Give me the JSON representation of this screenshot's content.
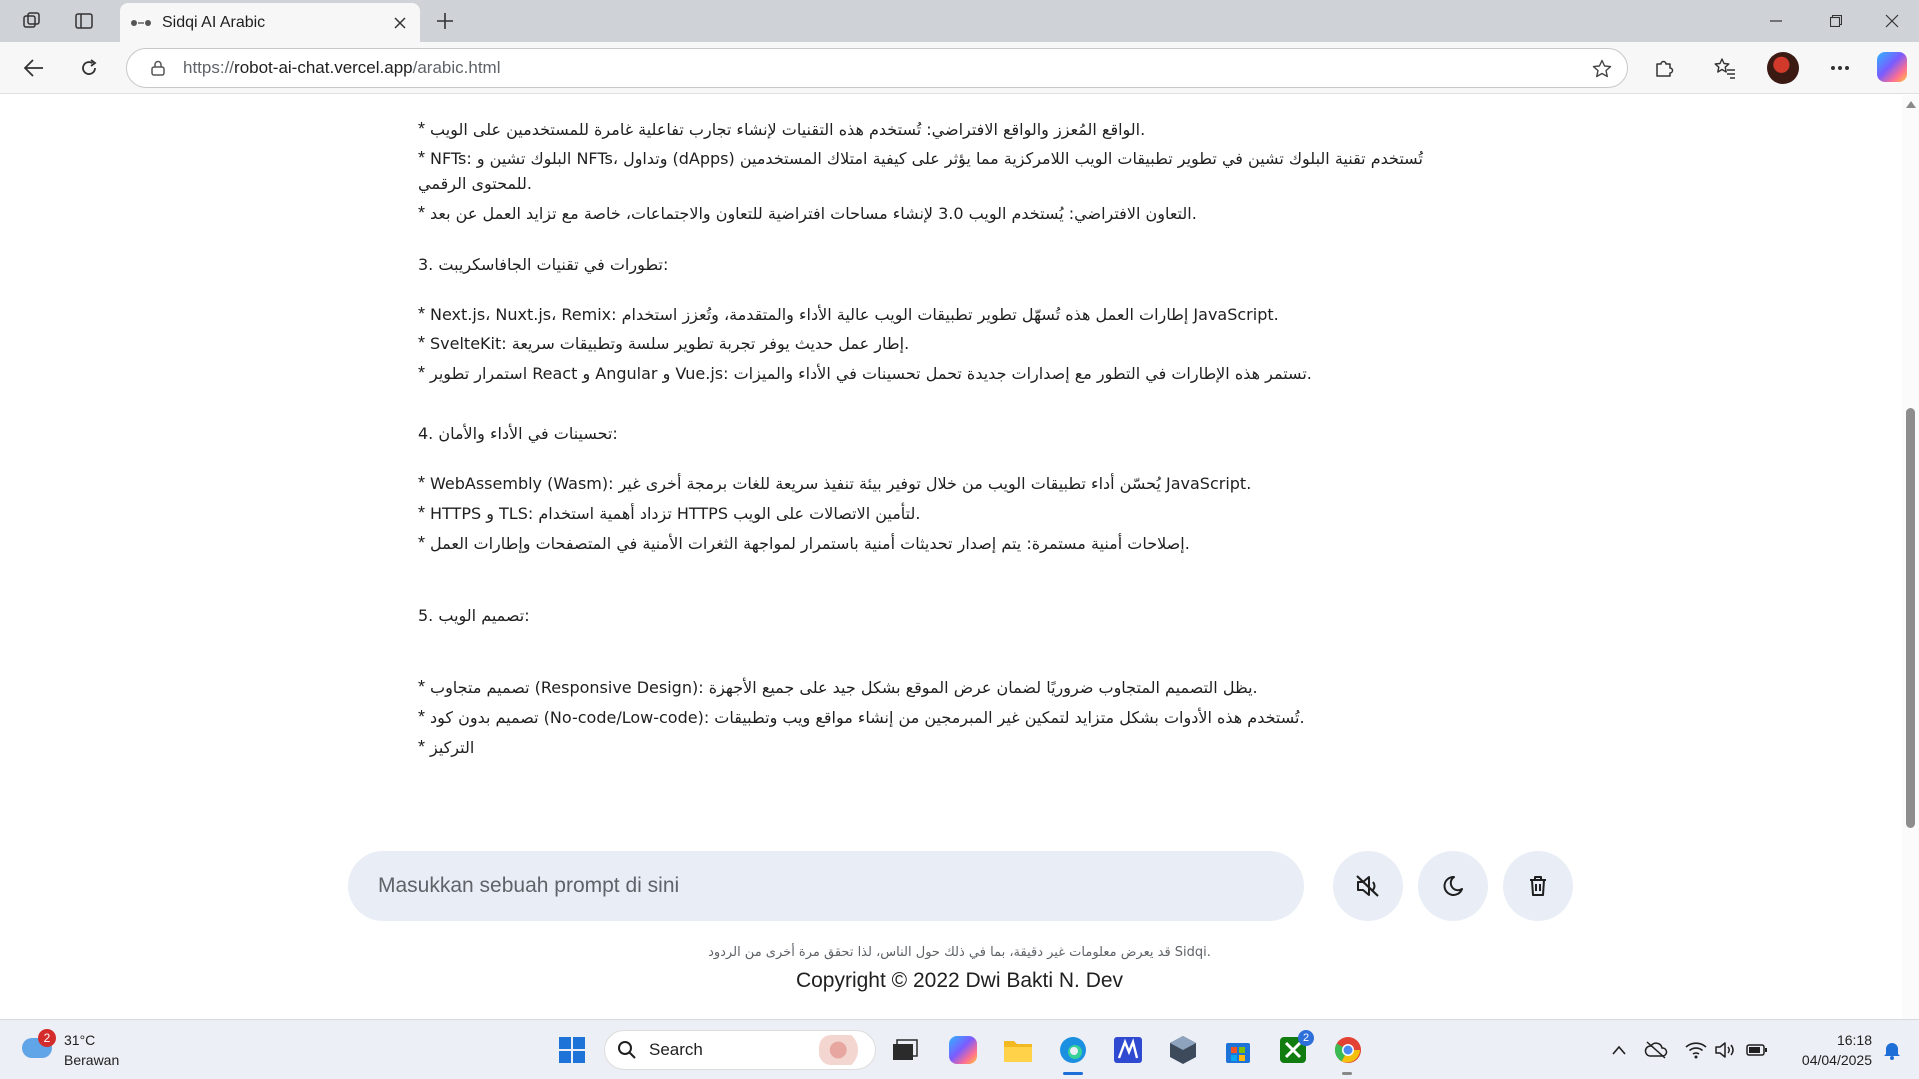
{
  "browser": {
    "tab_title": "Sidqi AI Arabic",
    "url_prefix": "https://",
    "url_host": "robot-ai-chat.vercel.app",
    "url_path": "/arabic.html"
  },
  "content": {
    "lines": [
      {
        "text": "الواقع المُعزز والواقع الافتراضي: تُستخدم هذه التقنيات لإنشاء تجارب تفاعلية غامرة للمستخدمين على الويب.",
        "prefix": "* "
      },
      {
        "text": "NFTs: البلوك تشين و NFTs، وتداول (dApps) تُستخدم تقنية البلوك تشين في تطوير تطبيقات الويب اللامركزية مما يؤثر على كيفية امتلاك المستخدمين",
        "prefix": "* "
      },
      {
        "text": "للمحتوى الرقمي.",
        "prefix": ""
      },
      {
        "text": "التعاون الافتراضي: يُستخدم الويب 3.0 لإنشاء مساحات افتراضية للتعاون والاجتماعات، خاصة مع تزايد العمل عن بعد.",
        "prefix": "* "
      },
      {
        "text": "3. تطورات في تقنيات الجافاسكريبت:",
        "prefix": ""
      },
      {
        "text": "Next.js، Nuxt.js، Remix: إطارات العمل هذه تُسهّل تطوير تطبيقات الويب عالية الأداء والمتقدمة، وتُعزز استخدام JavaScript.",
        "prefix": "* "
      },
      {
        "text": "SvelteKit: إطار عمل حديث يوفر تجربة تطوير سلسة وتطبيقات سريعة.",
        "prefix": "* "
      },
      {
        "text": "استمرار تطوير React و Angular و Vue.js: تستمر هذه الإطارات في التطور مع إصدارات جديدة تحمل تحسينات في الأداء والميزات.",
        "prefix": "* "
      },
      {
        "text": "4. تحسينات في الأداء والأمان:",
        "prefix": ""
      },
      {
        "text": "WebAssembly (Wasm): يُحسّن أداء تطبيقات الويب من خلال توفير بيئة تنفيذ سريعة للغات برمجة أخرى غير JavaScript.",
        "prefix": "* "
      },
      {
        "text": "HTTPS و TLS: تزداد أهمية استخدام HTTPS لتأمين الاتصالات على الويب.",
        "prefix": "* "
      },
      {
        "text": "إصلاحات أمنية مستمرة: يتم إصدار تحديثات أمنية باستمرار لمواجهة الثغرات الأمنية في المتصفحات وإطارات العمل.",
        "prefix": "* "
      },
      {
        "text": "5. تصميم الويب:",
        "prefix": ""
      },
      {
        "text": "تصميم متجاوب (Responsive Design): يظل التصميم المتجاوب ضروريًا لضمان عرض الموقع بشكل جيد على جميع الأجهزة.",
        "prefix": "* "
      },
      {
        "text": "تصميم بدون كود (No-code/Low-code): تُستخدم هذه الأدوات بشكل متزايد لتمكين غير المبرمجين من إنشاء مواقع ويب وتطبيقات.",
        "prefix": "* "
      },
      {
        "text": "التركيز",
        "prefix": "* "
      }
    ]
  },
  "prompt": {
    "placeholder": "Masukkan sebuah prompt di sini"
  },
  "footer": {
    "disclaimer": "قد يعرض معلومات غير دقيقة، بما في ذلك حول الناس، لذا تحقق مرة أخرى من الردود Sidqi.",
    "copyright": "Copyright © 2022 Dwi Bakti N. Dev"
  },
  "taskbar": {
    "weather_badge": "2",
    "temperature": "31°C",
    "condition": "Berawan",
    "search_label": "Search",
    "xbox_badge": "2",
    "time": "16:18",
    "date": "04/04/2025"
  },
  "colors": {
    "accent": "#1e6ed8",
    "prompt_bg": "#e9eef6"
  }
}
